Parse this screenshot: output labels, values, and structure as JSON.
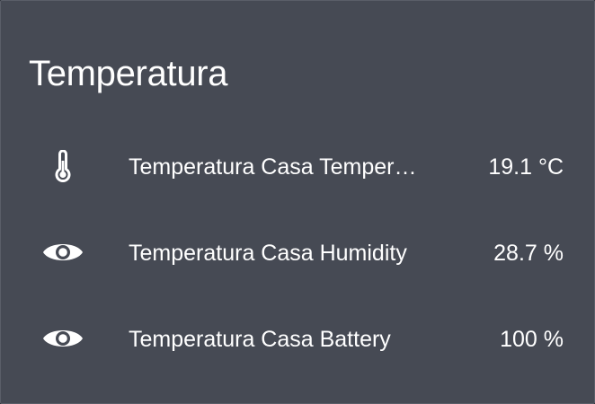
{
  "card": {
    "title": "Temperatura",
    "entities": [
      {
        "icon": "thermometer-icon",
        "name": "Temperatura Casa Temper…",
        "value": "19.1 °C"
      },
      {
        "icon": "eye-icon",
        "name": "Temperatura Casa Humidity",
        "value": "28.7 %"
      },
      {
        "icon": "eye-icon",
        "name": "Temperatura Casa Battery",
        "value": "100 %"
      }
    ]
  },
  "colors": {
    "card_background": "#464a54",
    "text": "#ffffff"
  }
}
